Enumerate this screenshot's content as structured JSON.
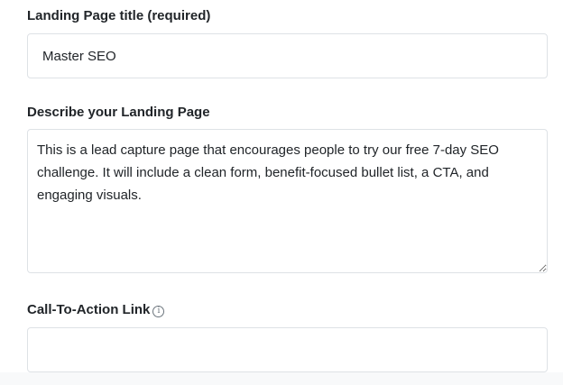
{
  "form": {
    "title_field": {
      "label": "Landing Page title (required)",
      "value": "Master SEO",
      "placeholder": ""
    },
    "description_field": {
      "label": "Describe your Landing Page",
      "value": "This is a lead capture page that encourages people to try our free 7-day SEO challenge. It will include a clean form, benefit-focused bullet list, a CTA, and engaging visuals.",
      "placeholder": ""
    },
    "cta_field": {
      "label": "Call-To-Action Link",
      "info_icon": "info-circle-icon",
      "info_glyph": "i",
      "value": "",
      "placeholder": ""
    }
  }
}
